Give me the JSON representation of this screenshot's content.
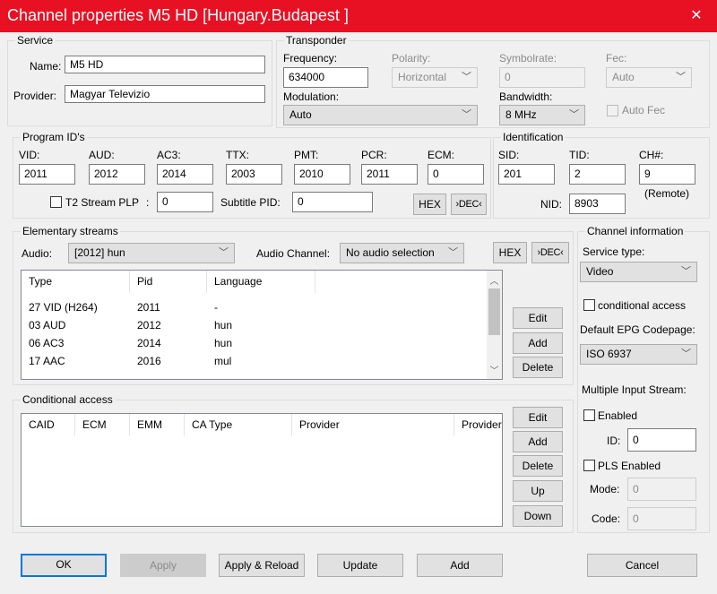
{
  "window": {
    "title": "Channel properties M5 HD [Hungary.Budapest ]"
  },
  "service": {
    "label": "Service",
    "name_label": "Name:",
    "name_value": "M5 HD",
    "provider_label": "Provider:",
    "provider_value": "Magyar Televizio"
  },
  "transponder": {
    "label": "Transponder",
    "frequency_label": "Frequency:",
    "frequency_value": "634000",
    "polarity_label": "Polarity:",
    "polarity_value": "Horizontal",
    "symbolrate_label": "Symbolrate:",
    "symbolrate_value": "0",
    "fec_label": "Fec:",
    "fec_value": "Auto",
    "modulation_label": "Modulation:",
    "modulation_value": "Auto",
    "bandwidth_label": "Bandwidth:",
    "bandwidth_value": "8 MHz",
    "autofec_label": "Auto Fec"
  },
  "program_ids": {
    "label": "Program ID's",
    "vid_label": "VID:",
    "vid": "2011",
    "aud_label": "AUD:",
    "aud": "2012",
    "ac3_label": "AC3:",
    "ac3": "2014",
    "ttx_label": "TTX:",
    "ttx": "2003",
    "pmt_label": "PMT:",
    "pmt": "2010",
    "pcr_label": "PCR:",
    "pcr": "2011",
    "ecm_label": "ECM:",
    "ecm": "0",
    "t2_label": "T2 Stream PLP",
    "t2_colon": ":",
    "t2_value": "0",
    "subtitle_label": "Subtitle PID:",
    "subtitle_value": "0",
    "hex": "HEX",
    "dec": "›DEC‹"
  },
  "identification": {
    "label": "Identification",
    "sid_label": "SID:",
    "sid": "201",
    "tid_label": "TID:",
    "tid": "2",
    "ch_label": "CH#:",
    "ch": "9",
    "remote": "(Remote)",
    "nid_label": "NID:",
    "nid": "8903"
  },
  "elementary": {
    "label": "Elementary streams",
    "audio_label": "Audio:",
    "audio_value": "[2012] hun",
    "audio_channel_label": "Audio Channel:",
    "audio_channel_value": "No audio selection",
    "hex": "HEX",
    "dec": "›DEC‹",
    "columns": [
      "Type",
      "Pid",
      "Language"
    ],
    "rows": [
      [
        "27 VID (H264)",
        "2011",
        "-"
      ],
      [
        "03 AUD",
        "2012",
        "hun"
      ],
      [
        "06 AC3",
        "2014",
        "hun"
      ],
      [
        "17 AAC",
        "2016",
        "mul"
      ]
    ],
    "edit": "Edit",
    "add": "Add",
    "delete": "Delete"
  },
  "conditional_access": {
    "label": "Conditional access",
    "columns": [
      "CAID",
      "ECM",
      "EMM",
      "CA Type",
      "Provider",
      "Provider"
    ],
    "edit": "Edit",
    "add": "Add",
    "delete": "Delete",
    "up": "Up",
    "down": "Down"
  },
  "channel_info": {
    "label": "Channel information",
    "service_type_label": "Service type:",
    "service_type_value": "Video",
    "conditional_access_label": "conditional access",
    "epg_label": "Default EPG Codepage:",
    "epg_value": "ISO 6937",
    "multi_input_label": "Multiple Input Stream:",
    "enabled_label": "Enabled",
    "id_label": "ID:",
    "id_value": "0",
    "pls_label": "PLS Enabled",
    "mode_label": "Mode:",
    "mode_value": "0",
    "code_label": "Code:",
    "code_value": "0"
  },
  "footer": {
    "ok": "OK",
    "apply": "Apply",
    "apply_reload": "Apply & Reload",
    "update": "Update",
    "add": "Add",
    "cancel": "Cancel"
  }
}
